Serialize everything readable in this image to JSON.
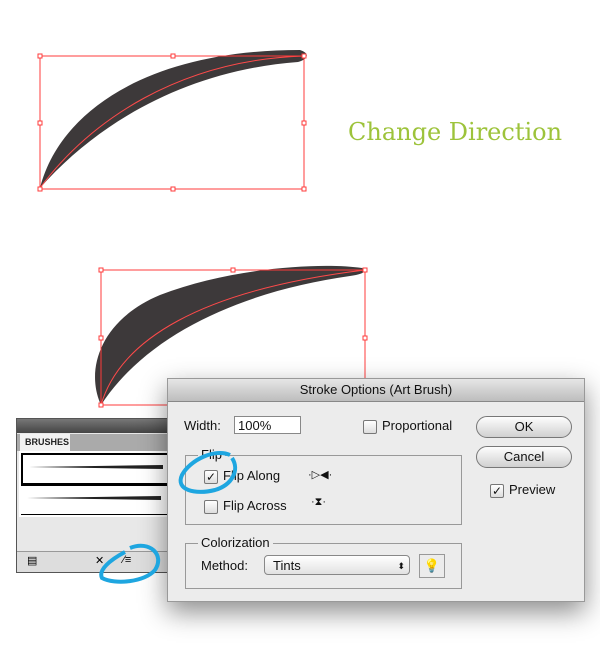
{
  "heading": "Change Direction",
  "colors": {
    "heading": "#9dc33b",
    "selection": "#ff3b3b",
    "shape": "#3d393a",
    "highlight": "#1ea6e0"
  },
  "brushes_panel": {
    "tab": "BRUSHES",
    "brush_count": 2,
    "footer_icons": [
      "brush-libraries-icon",
      "remove-stroke-icon",
      "stroke-options-icon"
    ]
  },
  "dialog": {
    "title": "Stroke Options (Art Brush)",
    "width_label": "Width:",
    "width_value": "100%",
    "proportional": {
      "label": "Proportional",
      "checked": false
    },
    "ok": "OK",
    "cancel": "Cancel",
    "preview": {
      "label": "Preview",
      "checked": true
    },
    "flip": {
      "legend": "Flip",
      "along": {
        "label": "Flip Along",
        "checked": true
      },
      "across": {
        "label": "Flip Across",
        "checked": false
      }
    },
    "colorization": {
      "legend": "Colorization",
      "method_label": "Method:",
      "method_value": "Tints"
    }
  }
}
